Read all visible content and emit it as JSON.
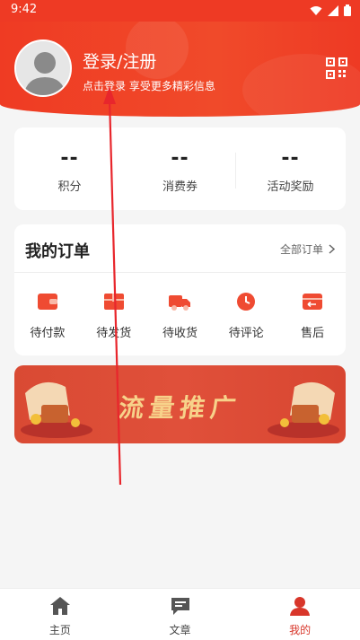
{
  "status_bar": {
    "time": "9:42"
  },
  "header": {
    "login_title": "登录/注册",
    "login_subtitle": "点击登录 享受更多精彩信息"
  },
  "stats": [
    {
      "value": "--",
      "label": "积分"
    },
    {
      "value": "--",
      "label": "消费券"
    },
    {
      "value": "--",
      "label": "活动奖励"
    }
  ],
  "orders": {
    "title": "我的订单",
    "all_orders": "全部订单",
    "items": [
      {
        "label": "待付款",
        "icon": "wallet-icon"
      },
      {
        "label": "待发货",
        "icon": "package-icon"
      },
      {
        "label": "待收货",
        "icon": "truck-icon"
      },
      {
        "label": "待评论",
        "icon": "clock-icon"
      },
      {
        "label": "售后",
        "icon": "return-icon"
      }
    ]
  },
  "banner": {
    "text": "流量推广"
  },
  "tabbar": {
    "items": [
      {
        "label": "主页",
        "icon": "home-icon",
        "active": false
      },
      {
        "label": "文章",
        "icon": "article-icon",
        "active": false
      },
      {
        "label": "我的",
        "icon": "profile-icon",
        "active": true
      }
    ]
  },
  "colors": {
    "brand_red": "#ee3a24",
    "active_tab": "#d8362a",
    "banner_text": "#f7d28a"
  }
}
